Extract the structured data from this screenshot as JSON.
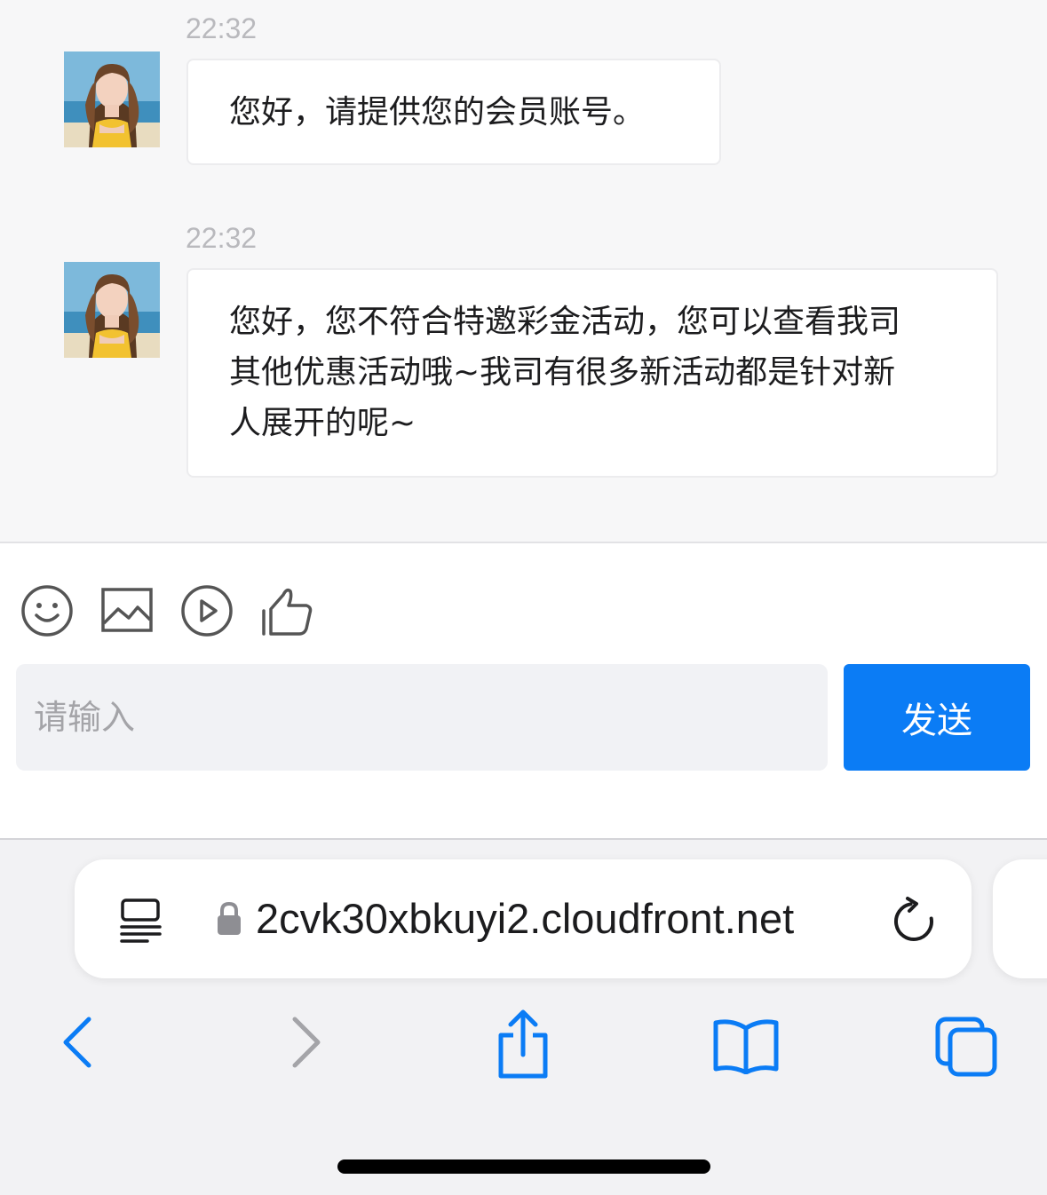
{
  "messages": [
    {
      "time": "22:32",
      "text": "您好，请提供您的会员账号。"
    },
    {
      "time": "22:32",
      "lines": [
        "您好，您不符合特邀彩金活动，您可以查看我司",
        "其他优惠活动哦~我司有很多新活动都是针对新",
        "人展开的呢~"
      ]
    }
  ],
  "toolbar": {
    "icons": [
      "emoji-icon",
      "image-icon",
      "video-icon",
      "thumbs-up-icon"
    ]
  },
  "composer": {
    "placeholder": "请输入",
    "value": "",
    "send_label": "发送"
  },
  "browser": {
    "url": "2cvk30xbkuyi2.cloudfront.net",
    "icons": [
      "reader-icon",
      "lock-icon",
      "reload-icon",
      "back-icon",
      "forward-icon",
      "share-icon",
      "bookmarks-icon",
      "tabs-icon"
    ],
    "accent_color": "#0b7cf5"
  }
}
